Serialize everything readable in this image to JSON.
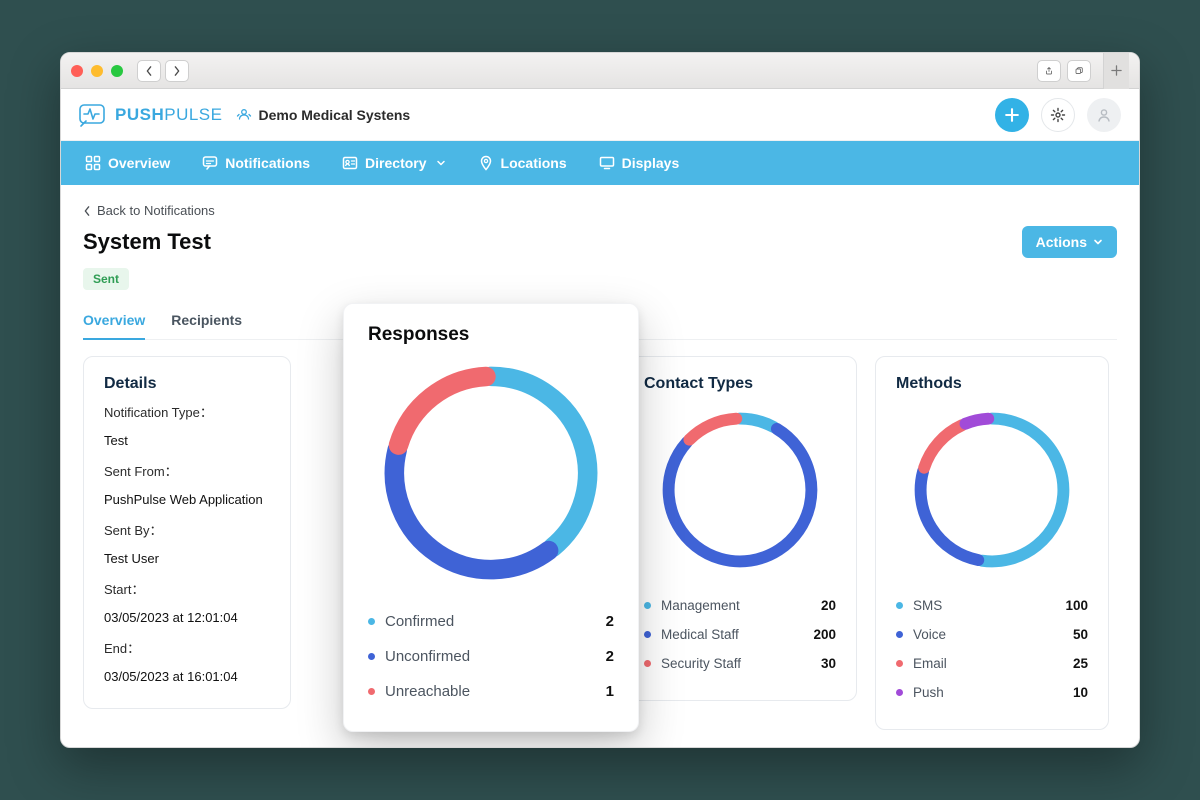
{
  "browser": {
    "back_icon": "chevron-left",
    "fwd_icon": "chevron-right",
    "share_icon": "share",
    "tabs_icon": "tabs",
    "newtab_icon": "plus"
  },
  "header": {
    "brand_strong": "PUSH",
    "brand_light": "PULSE",
    "org_name": "Demo Medical Systens"
  },
  "nav": {
    "items": [
      {
        "label": "Overview",
        "icon": "grid"
      },
      {
        "label": "Notifications",
        "icon": "chat"
      },
      {
        "label": "Directory",
        "icon": "id",
        "dropdown": true
      },
      {
        "label": "Locations",
        "icon": "pin"
      },
      {
        "label": "Displays",
        "icon": "monitor"
      }
    ]
  },
  "back_link": "Back to Notifications",
  "page_title": "System Test",
  "actions_label": "Actions",
  "status_badge": "Sent",
  "tabs": {
    "overview": "Overview",
    "recipients": "Recipients"
  },
  "details": {
    "title": "Details",
    "rows": [
      {
        "label": "Notification Type：",
        "value": "Test"
      },
      {
        "label": "Sent From：",
        "value": "PushPulse Web Application"
      },
      {
        "label": "Sent By：",
        "value": "Test User"
      },
      {
        "label": "Start：",
        "value": "03/05/2023 at 12:01:04"
      },
      {
        "label": "End：",
        "value": "03/05/2023 at 16:01:04"
      }
    ]
  },
  "responses": {
    "title": "Responses",
    "items": [
      {
        "label": "Confirmed",
        "value": 2,
        "color": "#4bb7e5"
      },
      {
        "label": "Unconfirmed",
        "value": 2,
        "color": "#3f63d6"
      },
      {
        "label": "Unreachable",
        "value": 1,
        "color": "#f06a6f"
      }
    ]
  },
  "contact_types": {
    "title": "Contact Types",
    "items": [
      {
        "label": "Management",
        "value": 20,
        "color": "#4bb7e5"
      },
      {
        "label": "Medical Staff",
        "value": 200,
        "color": "#3f63d6"
      },
      {
        "label": "Security Staff",
        "value": 30,
        "color": "#f06a6f"
      }
    ]
  },
  "methods": {
    "title": "Methods",
    "items": [
      {
        "label": "SMS",
        "value": 100,
        "color": "#4bb7e5"
      },
      {
        "label": "Voice",
        "value": 50,
        "color": "#3f63d6"
      },
      {
        "label": "Email",
        "value": 25,
        "color": "#f06a6f"
      },
      {
        "label": "Push",
        "value": 10,
        "color": "#a14bd8"
      }
    ]
  },
  "chart_data": [
    {
      "type": "pie",
      "title": "Responses",
      "series": [
        {
          "name": "Confirmed",
          "value": 2,
          "color": "#4bb7e5"
        },
        {
          "name": "Unconfirmed",
          "value": 2,
          "color": "#3f63d6"
        },
        {
          "name": "Unreachable",
          "value": 1,
          "color": "#f06a6f"
        }
      ]
    },
    {
      "type": "pie",
      "title": "Contact Types",
      "series": [
        {
          "name": "Management",
          "value": 20,
          "color": "#4bb7e5"
        },
        {
          "name": "Medical Staff",
          "value": 200,
          "color": "#3f63d6"
        },
        {
          "name": "Security Staff",
          "value": 30,
          "color": "#f06a6f"
        }
      ]
    },
    {
      "type": "pie",
      "title": "Methods",
      "series": [
        {
          "name": "SMS",
          "value": 100,
          "color": "#4bb7e5"
        },
        {
          "name": "Voice",
          "value": 50,
          "color": "#3f63d6"
        },
        {
          "name": "Email",
          "value": 25,
          "color": "#f06a6f"
        },
        {
          "name": "Push",
          "value": 10,
          "color": "#a14bd8"
        }
      ]
    }
  ]
}
